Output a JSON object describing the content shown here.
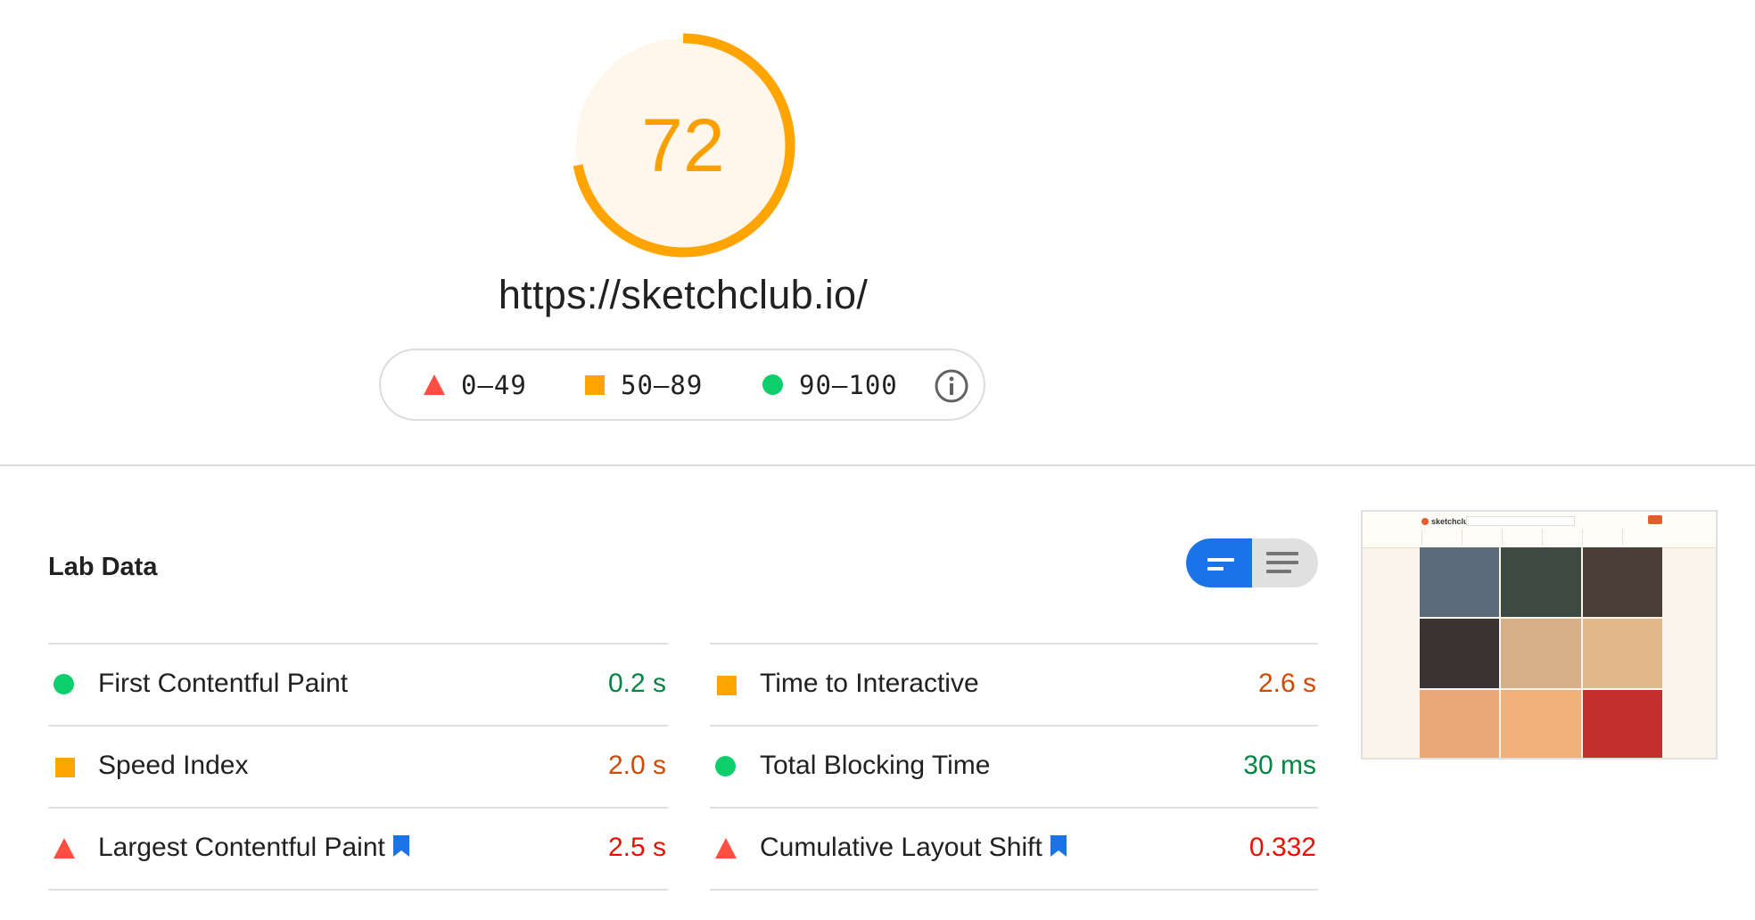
{
  "score": {
    "value": "72",
    "fraction": 0.72,
    "color": "#ffa400",
    "text_color": "#fa9f00",
    "background": "#fff6ec"
  },
  "url": "https://sketchclub.io/",
  "legend": {
    "fail": {
      "range": "0–49",
      "color": "#ff4e42",
      "shape": "triangle"
    },
    "average": {
      "range": "50–89",
      "color": "#ffa400",
      "shape": "square"
    },
    "pass": {
      "range": "90–100",
      "color": "#0cce6b",
      "shape": "circle"
    },
    "info_icon": "info-circle-icon"
  },
  "lab_data": {
    "title": "Lab Data",
    "toggle": {
      "expanded_icon": "view-expanded-icon",
      "list_icon": "view-list-icon",
      "active": "expanded",
      "active_color": "#1a73e8"
    },
    "metrics_left": [
      {
        "name": "First Contentful Paint",
        "value": "0.2 s",
        "rating": "pass",
        "bookmark": false
      },
      {
        "name": "Speed Index",
        "value": "2.0 s",
        "rating": "average",
        "bookmark": false
      },
      {
        "name": "Largest Contentful Paint",
        "value": "2.5 s",
        "rating": "fail",
        "bookmark": true
      }
    ],
    "metrics_right": [
      {
        "name": "Time to Interactive",
        "value": "2.6 s",
        "rating": "average",
        "bookmark": false
      },
      {
        "name": "Total Blocking Time",
        "value": "30 ms",
        "rating": "pass",
        "bookmark": false
      },
      {
        "name": "Cumulative Layout Shift",
        "value": "0.332",
        "rating": "fail",
        "bookmark": true
      }
    ],
    "rating_colors": {
      "pass": "#018642",
      "average": "#d04900",
      "fail": "#eb0f00"
    },
    "bookmark_color": "#1a73e8"
  },
  "screenshot": {
    "site_logo": "sketchclub",
    "tiles": [
      "#5a6a78",
      "#3d4a44",
      "#4a3d35",
      "#3a3432",
      "#d7b08a",
      "#e2b78c",
      "#e8a878",
      "#f1b079",
      "#c2302e"
    ]
  }
}
